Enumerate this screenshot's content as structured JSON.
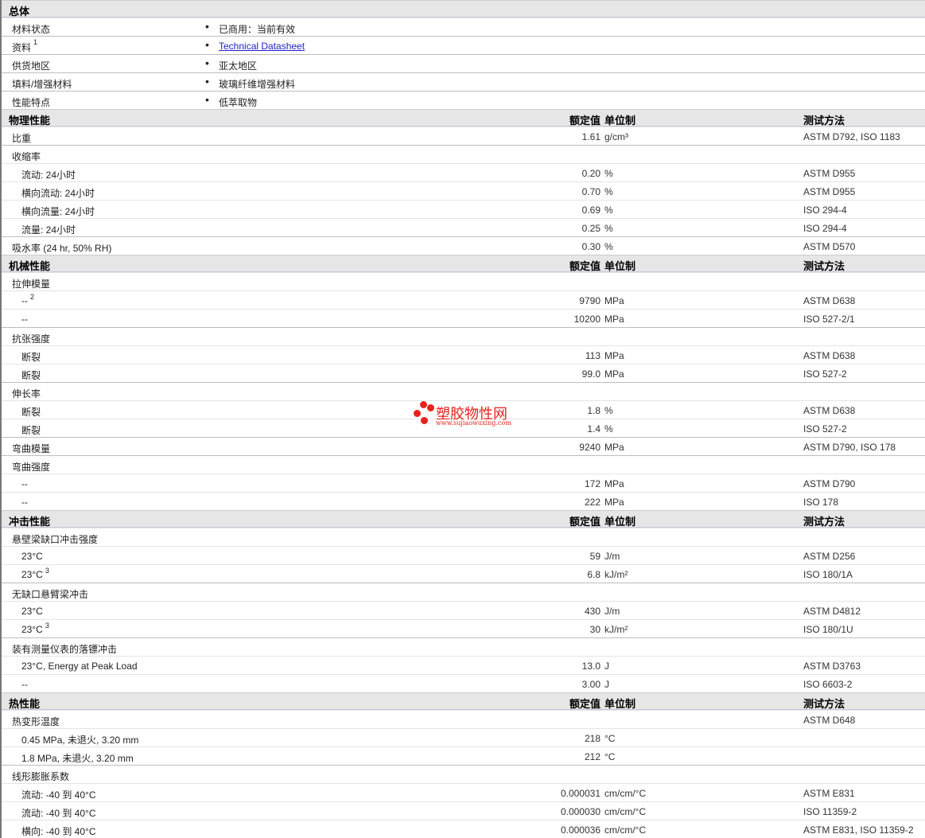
{
  "headers": {
    "value": "额定值",
    "unit": "单位制",
    "method": "测试方法"
  },
  "sections": [
    {
      "title": "总体",
      "general": true,
      "rows": [
        {
          "label": "材料状态",
          "text": "已商用：当前有效"
        },
        {
          "label": "资料",
          "sup": "1",
          "text": "Technical Datasheet",
          "link": true
        },
        {
          "label": "供货地区",
          "text": "亚太地区"
        },
        {
          "label": "填料/增强材料",
          "text": "玻璃纤维增强材料"
        },
        {
          "label": "性能特点",
          "text": "低萃取物"
        }
      ]
    },
    {
      "title": "物理性能",
      "rows": [
        {
          "label": "比重",
          "value": "1.61",
          "unit": "g/cm³",
          "method": "ASTM D792, ISO 1183"
        },
        {
          "label": "收缩率"
        },
        {
          "label": "流动: 24小时",
          "indent": 1,
          "value": "0.20",
          "unit": "%",
          "method": "ASTM D955"
        },
        {
          "label": "横向流动: 24小时",
          "indent": 1,
          "value": "0.70",
          "unit": "%",
          "method": "ASTM D955"
        },
        {
          "label": "横向流量: 24小时",
          "indent": 1,
          "value": "0.69",
          "unit": "%",
          "method": "ISO 294-4"
        },
        {
          "label": "流量: 24小时",
          "indent": 1,
          "value": "0.25",
          "unit": "%",
          "method": "ISO 294-4"
        },
        {
          "label": "吸水率 (24 hr, 50% RH)",
          "value": "0.30",
          "unit": "%",
          "method": "ASTM D570"
        }
      ]
    },
    {
      "title": "机械性能",
      "rows": [
        {
          "label": "拉伸模量"
        },
        {
          "label": "--",
          "sup": "2",
          "indent": 1,
          "value": "9790",
          "unit": "MPa",
          "method": "ASTM D638"
        },
        {
          "label": "--",
          "indent": 1,
          "value": "10200",
          "unit": "MPa",
          "method": "ISO 527-2/1"
        },
        {
          "label": "抗张强度"
        },
        {
          "label": "断裂",
          "indent": 1,
          "value": "113",
          "unit": "MPa",
          "method": "ASTM D638"
        },
        {
          "label": "断裂",
          "indent": 1,
          "value": "99.0",
          "unit": "MPa",
          "method": "ISO 527-2"
        },
        {
          "label": "伸长率"
        },
        {
          "label": "断裂",
          "indent": 1,
          "value": "1.8",
          "unit": "%",
          "method": "ASTM D638"
        },
        {
          "label": "断裂",
          "indent": 1,
          "value": "1.4",
          "unit": "%",
          "method": "ISO 527-2"
        },
        {
          "label": "弯曲模量",
          "value": "9240",
          "unit": "MPa",
          "method": "ASTM D790, ISO 178"
        },
        {
          "label": "弯曲强度"
        },
        {
          "label": "--",
          "indent": 1,
          "value": "172",
          "unit": "MPa",
          "method": "ASTM D790"
        },
        {
          "label": "--",
          "indent": 1,
          "value": "222",
          "unit": "MPa",
          "method": "ISO 178"
        }
      ]
    },
    {
      "title": "冲击性能",
      "rows": [
        {
          "label": "悬壁梁缺口冲击强度"
        },
        {
          "label": "23°C",
          "indent": 1,
          "value": "59",
          "unit": "J/m",
          "method": "ASTM D256"
        },
        {
          "label": "23°C",
          "sup": "3",
          "indent": 1,
          "value": "6.8",
          "unit": "kJ/m²",
          "method": "ISO 180/1A"
        },
        {
          "label": "无缺口悬臂梁冲击"
        },
        {
          "label": "23°C",
          "indent": 1,
          "value": "430",
          "unit": "J/m",
          "method": "ASTM D4812"
        },
        {
          "label": "23°C",
          "sup": "3",
          "indent": 1,
          "value": "30",
          "unit": "kJ/m²",
          "method": "ISO 180/1U"
        },
        {
          "label": "装有测量仪表的落镖冲击"
        },
        {
          "label": "23°C, Energy at Peak Load",
          "indent": 1,
          "value": "13.0",
          "unit": "J",
          "method": "ASTM D3763"
        },
        {
          "label": "--",
          "indent": 1,
          "value": "3.00",
          "unit": "J",
          "method": "ISO 6603-2"
        }
      ]
    },
    {
      "title": "热性能",
      "rows": [
        {
          "label": "热变形温度",
          "method": "ASTM D648"
        },
        {
          "label": "0.45 MPa, 未退火, 3.20 mm",
          "indent": 1,
          "value": "218",
          "unit": "°C"
        },
        {
          "label": "1.8 MPa, 未退火, 3.20 mm",
          "indent": 1,
          "value": "212",
          "unit": "°C"
        },
        {
          "label": "线形膨胀系数"
        },
        {
          "label": "流动: -40 到  40°C",
          "indent": 1,
          "value": "0.000031",
          "unit": "cm/cm/°C",
          "method": "ASTM E831"
        },
        {
          "label": "流动: -40 到  40°C",
          "indent": 1,
          "value": "0.000030",
          "unit": "cm/cm/°C",
          "method": "ISO 11359-2"
        },
        {
          "label": "横向: -40 到  40°C",
          "indent": 1,
          "value": "0.000036",
          "unit": "cm/cm/°C",
          "method": "ASTM E831, ISO 11359-2"
        }
      ]
    }
  ],
  "watermark": {
    "cn": "塑胶物性网",
    "en": "www.sujiaowuxing.com",
    "color": "#e8221c"
  }
}
